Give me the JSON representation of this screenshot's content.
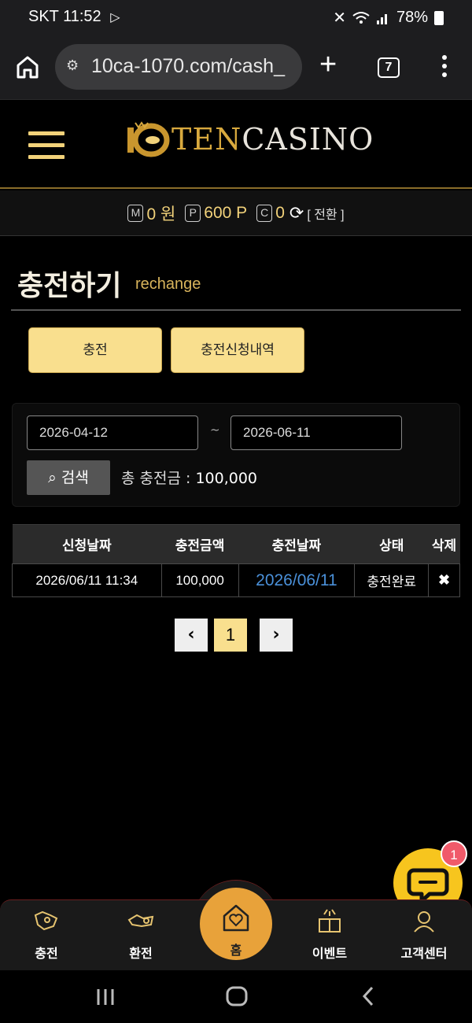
{
  "status_bar": {
    "carrier": "SKT",
    "time": "11:52",
    "battery": "78%"
  },
  "browser": {
    "url": "10ca-1070.com/cash_",
    "tab_count": "7"
  },
  "site": {
    "logo_ten": "TEN",
    "logo_casino": "CASINO"
  },
  "balance": {
    "money_badge": "M",
    "money": "0 원",
    "point_badge": "P",
    "points": "600 P",
    "comp_badge": "C",
    "comp": "0",
    "convert_label": "[ 전환 ]"
  },
  "page": {
    "title": "충전하기",
    "subtitle": "rechange"
  },
  "tabs": [
    {
      "label": "충전"
    },
    {
      "label": "충전신청내역"
    }
  ],
  "search": {
    "start_date": "2026-04-12",
    "tilde": "~",
    "end_date": "2026-06-11",
    "button_label": "검색",
    "total_label": "총 충전금 : ",
    "total_value": "100,000"
  },
  "table": {
    "headers": [
      "신청날짜",
      "충전금액",
      "충전날짜",
      "상태",
      "삭제"
    ],
    "rows": [
      {
        "request_date": "2026/06/11 11:34",
        "amount": "100,000",
        "charge_date": "2026/06/11",
        "status": "충전완료",
        "delete": "✖"
      }
    ]
  },
  "pagination": {
    "prev": "‹",
    "current": "1",
    "next": "›"
  },
  "chat": {
    "badge_count": "1"
  },
  "bottom_nav": {
    "items": [
      {
        "label": "충전"
      },
      {
        "label": "환전"
      },
      {
        "label": "홈"
      },
      {
        "label": "이벤트"
      },
      {
        "label": "고객센터"
      }
    ]
  },
  "colors": {
    "gold": "#f9df8e",
    "gold_text": "#f2d27a",
    "orange": "#e8a23a",
    "chat_yellow": "#f7c51e",
    "link_blue": "#4a90d9"
  }
}
